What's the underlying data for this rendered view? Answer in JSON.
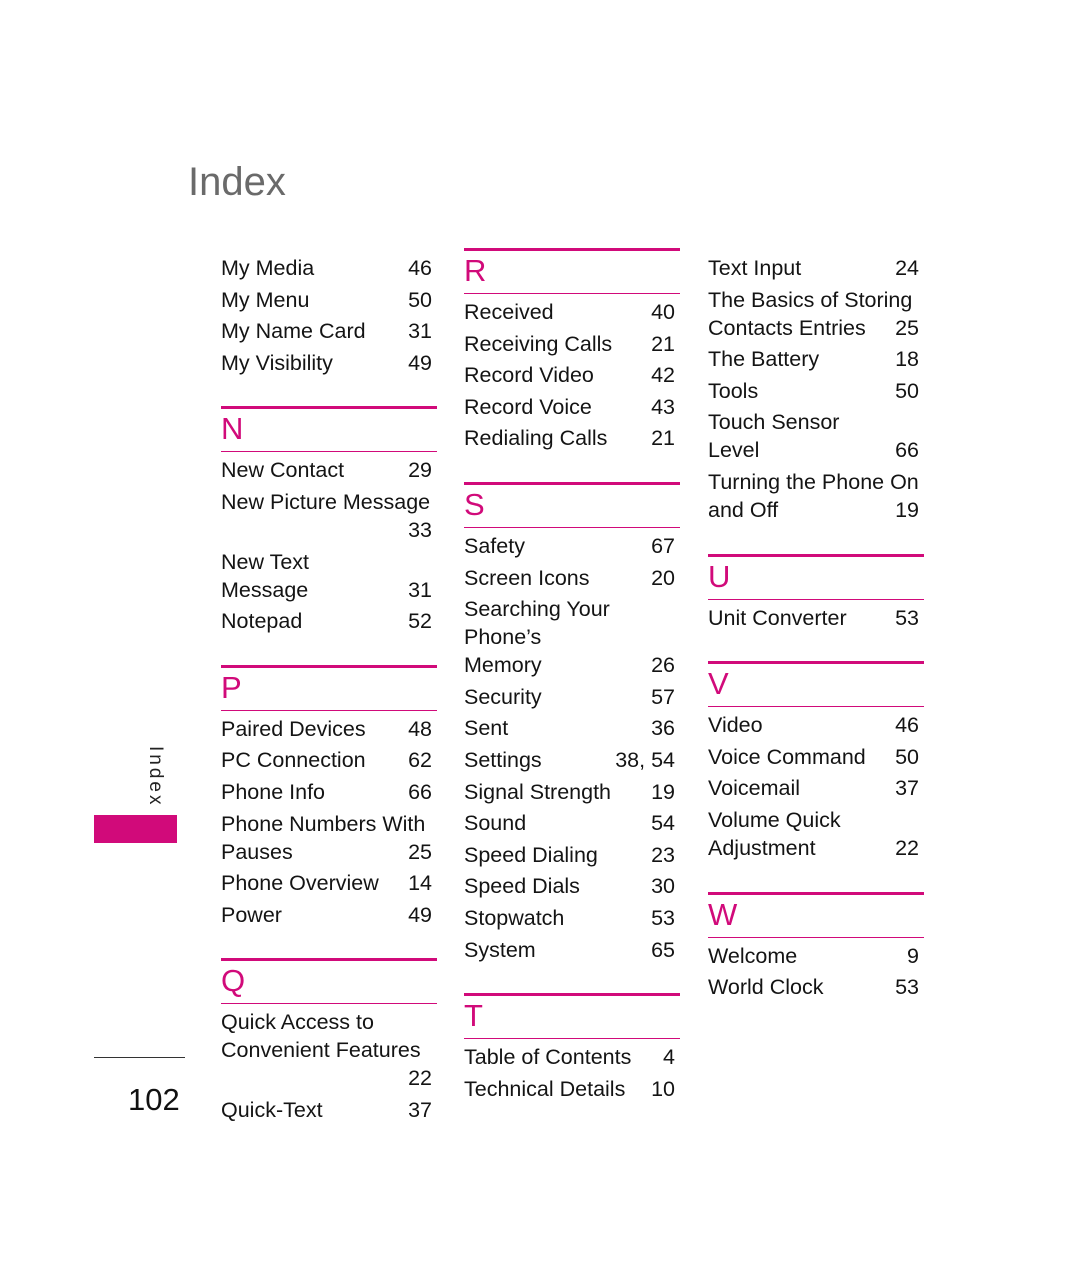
{
  "page": {
    "title": "Index",
    "side_tab_label": "Index",
    "page_number": "102",
    "accent_color": "#d10a7a"
  },
  "columns": [
    {
      "sections": [
        {
          "letter": "",
          "entries": [
            {
              "term": "My Media",
              "page": "46"
            },
            {
              "term": "My Menu",
              "page": "50"
            },
            {
              "term": "My Name Card",
              "page": "31"
            },
            {
              "term": "My Visibility",
              "page": "49"
            }
          ]
        },
        {
          "letter": "N",
          "entries": [
            {
              "term": "New Contact",
              "page": "29"
            },
            {
              "term": "New Picture Message",
              "page": "33"
            },
            {
              "term": "New Text Message",
              "page": "31"
            },
            {
              "term": "Notepad",
              "page": "52"
            }
          ]
        },
        {
          "letter": "P",
          "entries": [
            {
              "term": "Paired Devices",
              "page": "48"
            },
            {
              "term": "PC Connection",
              "page": "62"
            },
            {
              "term": "Phone Info",
              "page": "66"
            },
            {
              "term": "Phone Numbers With Pauses",
              "page": "25"
            },
            {
              "term": "Phone Overview",
              "page": "14"
            },
            {
              "term": "Power",
              "page": "49"
            }
          ]
        },
        {
          "letter": "Q",
          "entries": [
            {
              "term": "Quick Access to Convenient Features",
              "page": "22"
            },
            {
              "term": "Quick-Text",
              "page": "37"
            }
          ]
        }
      ]
    },
    {
      "sections": [
        {
          "letter": "R",
          "entries": [
            {
              "term": "Received",
              "page": "40"
            },
            {
              "term": "Receiving Calls",
              "page": "21"
            },
            {
              "term": "Record Video",
              "page": "42"
            },
            {
              "term": "Record Voice",
              "page": "43"
            },
            {
              "term": "Redialing Calls",
              "page": "21"
            }
          ]
        },
        {
          "letter": "S",
          "entries": [
            {
              "term": "Safety",
              "page": "67"
            },
            {
              "term": "Screen Icons",
              "page": "20"
            },
            {
              "term": "Searching Your Phone’s Memory",
              "page": "26"
            },
            {
              "term": "Security",
              "page": "57"
            },
            {
              "term": "Sent",
              "page": "36"
            },
            {
              "term": "Settings",
              "page": "38, 54"
            },
            {
              "term": "Signal Strength",
              "page": "19"
            },
            {
              "term": "Sound",
              "page": "54"
            },
            {
              "term": "Speed Dialing",
              "page": "23"
            },
            {
              "term": "Speed Dials",
              "page": "30"
            },
            {
              "term": "Stopwatch",
              "page": "53"
            },
            {
              "term": "System",
              "page": "65"
            }
          ]
        },
        {
          "letter": "T",
          "entries": [
            {
              "term": "Table of Contents",
              "page": "4"
            },
            {
              "term": "Technical Details",
              "page": "10"
            }
          ]
        }
      ]
    },
    {
      "sections": [
        {
          "letter": "",
          "entries": [
            {
              "term": "Text Input",
              "page": "24"
            },
            {
              "term": "The Basics of Storing Contacts Entries",
              "page": "25"
            },
            {
              "term": "The Battery",
              "page": "18"
            },
            {
              "term": "Tools",
              "page": "50"
            },
            {
              "term": "Touch Sensor Level",
              "page": "66"
            },
            {
              "term": "Turning the Phone On and Off",
              "page": "19"
            }
          ]
        },
        {
          "letter": "U",
          "entries": [
            {
              "term": "Unit Converter",
              "page": "53"
            }
          ]
        },
        {
          "letter": "V",
          "entries": [
            {
              "term": "Video",
              "page": "46"
            },
            {
              "term": "Voice Command",
              "page": "50"
            },
            {
              "term": "Voicemail",
              "page": "37"
            },
            {
              "term": "Volume Quick Adjustment",
              "page": "22"
            }
          ]
        },
        {
          "letter": "W",
          "entries": [
            {
              "term": "Welcome",
              "page": "9"
            },
            {
              "term": "World Clock",
              "page": "53"
            }
          ]
        }
      ]
    }
  ]
}
